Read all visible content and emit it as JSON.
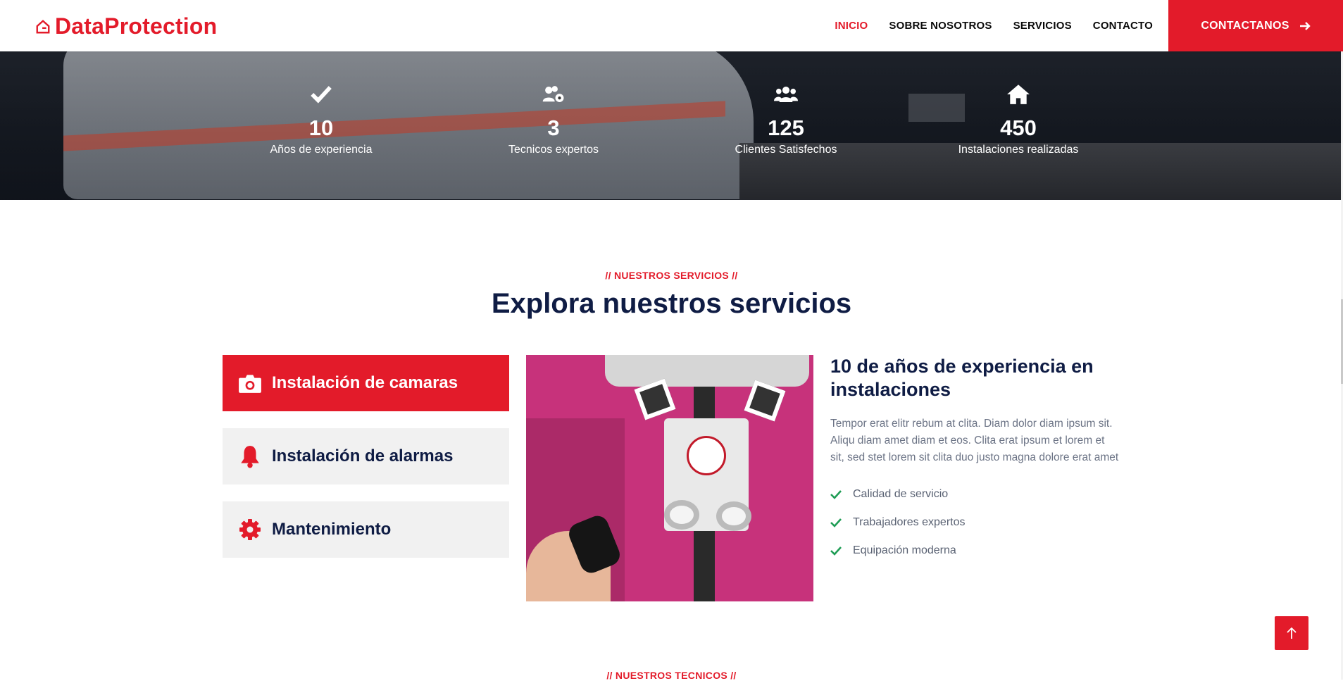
{
  "brand": {
    "name": "DataProtection"
  },
  "nav": {
    "items": [
      {
        "label": "INICIO",
        "active": true
      },
      {
        "label": "SOBRE NOSOTROS",
        "active": false
      },
      {
        "label": "SERVICIOS",
        "active": false
      },
      {
        "label": "CONTACTO",
        "active": false
      }
    ],
    "cta_label": "CONTACTANOS"
  },
  "stats": [
    {
      "icon": "check-icon",
      "value": "10",
      "label": "Años de experiencia"
    },
    {
      "icon": "users-cog-icon",
      "value": "3",
      "label": "Tecnicos expertos"
    },
    {
      "icon": "users-icon",
      "value": "125",
      "label": "Clientes Satisfechos"
    },
    {
      "icon": "home-icon",
      "value": "450",
      "label": "Instalaciones realizadas"
    }
  ],
  "services": {
    "eyebrow": "// NUESTROS SERVICIOS //",
    "title": "Explora nuestros servicios",
    "tabs": [
      {
        "icon": "camera-icon",
        "label": "Instalación de camaras",
        "active": true
      },
      {
        "icon": "bell-icon",
        "label": "Instalación de alarmas",
        "active": false
      },
      {
        "icon": "gear-icon",
        "label": "Mantenimiento",
        "active": false
      }
    ],
    "detail": {
      "title": "10 de años de experiencia en instalaciones",
      "text": "Tempor erat elitr rebum at clita. Diam dolor diam ipsum sit. Aliqu diam amet diam et eos. Clita erat ipsum et lorem et sit, sed stet lorem sit clita duo justo magna dolore erat amet",
      "features": [
        "Calidad de servicio",
        "Trabajadores expertos",
        "Equipación moderna"
      ]
    }
  },
  "technicians": {
    "eyebrow": "// NUESTROS TECNICOS //"
  },
  "colors": {
    "accent": "#e31b2a",
    "navy": "#0f1c44",
    "check": "#1f9d55",
    "tab_inactive": "#f1f1f1"
  }
}
